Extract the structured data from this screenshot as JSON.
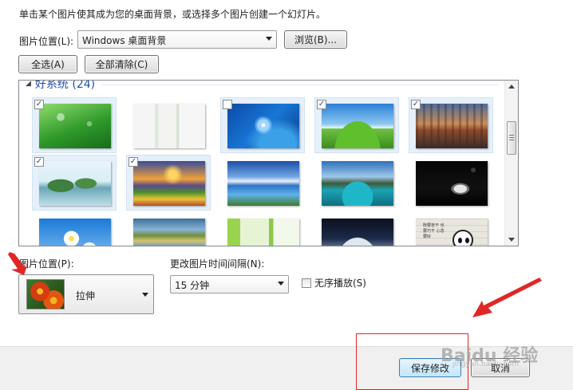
{
  "instruction": "单击某个图片使其成为您的桌面背景，或选择多个图片创建一个幻灯片。",
  "location_row": {
    "label": "图片位置(L):",
    "value": "Windows 桌面背景",
    "browse_label": "浏览(B)..."
  },
  "select_all_label": "全选(A)",
  "clear_all_label": "全部清除(C)",
  "gallery": {
    "group_label": "好系统 (24)",
    "tiles": [
      {
        "checked": true,
        "selected": true
      },
      {
        "checked": false,
        "selected": false
      },
      {
        "checked": false,
        "selected": true
      },
      {
        "checked": true,
        "selected": true
      },
      {
        "checked": true,
        "selected": true
      },
      {
        "checked": true,
        "selected": true
      },
      {
        "checked": true,
        "selected": true
      },
      {
        "checked": false,
        "selected": false
      },
      {
        "checked": false,
        "selected": false
      },
      {
        "checked": false,
        "selected": false
      },
      {
        "checked": false,
        "selected": false
      },
      {
        "checked": false,
        "selected": false
      },
      {
        "checked": false,
        "selected": false
      },
      {
        "checked": false,
        "selected": false
      },
      {
        "checked": false,
        "selected": false
      }
    ],
    "panda_text": "既要苦干 也要巧干 心态要好"
  },
  "position": {
    "label": "图片位置(P):",
    "value": "拉伸"
  },
  "interval": {
    "label": "更改图片时间间隔(N):",
    "value": "15 分钟"
  },
  "shuffle_label": "无序播放(S)",
  "save_label": "保存修改",
  "cancel_label": "取消",
  "watermark": {
    "text": "Baidu 经验",
    "url": "jingyan.baidu.com"
  },
  "colors": {
    "annotation_red": "#e02727",
    "group_blue": "#1e4ea8"
  }
}
